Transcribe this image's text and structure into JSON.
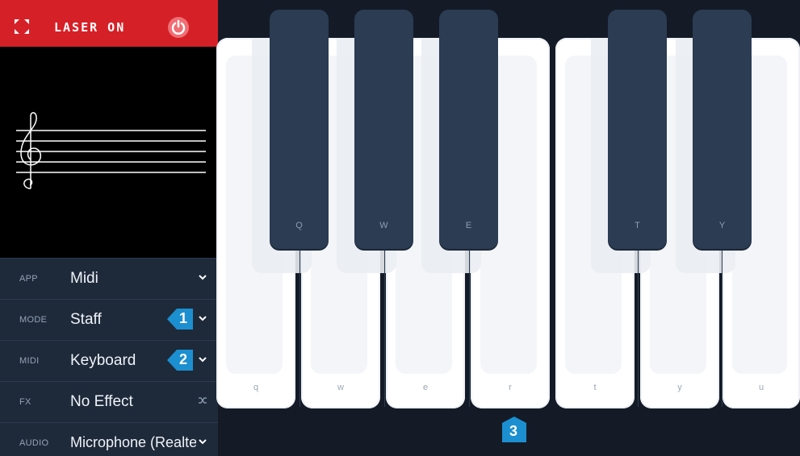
{
  "topbar": {
    "laser_label": "LASER ON",
    "expand_icon": "expand-icon",
    "power_icon": "power-icon",
    "accent": "#d62027"
  },
  "preview": {
    "content": "treble-clef-staff"
  },
  "settings": [
    {
      "label": "APP",
      "value": "Midi",
      "badge": ""
    },
    {
      "label": "MODE",
      "value": "Staff",
      "badge": "1"
    },
    {
      "label": "MIDI",
      "value": "Keyboard",
      "badge": "2"
    },
    {
      "label": "FX",
      "value": "No Effect",
      "badge": ""
    },
    {
      "label": "AUDIO",
      "value": "Microphone (Realtek",
      "badge": ""
    }
  ],
  "piano": {
    "white_keys": [
      "q",
      "w",
      "e",
      "r",
      "t",
      "y",
      "u"
    ],
    "black_keys": [
      "Q",
      "W",
      "E",
      "T",
      "Y"
    ],
    "marker": "3",
    "marker_color": "#1c8fd0",
    "black_key_color": "#2b3c53"
  }
}
